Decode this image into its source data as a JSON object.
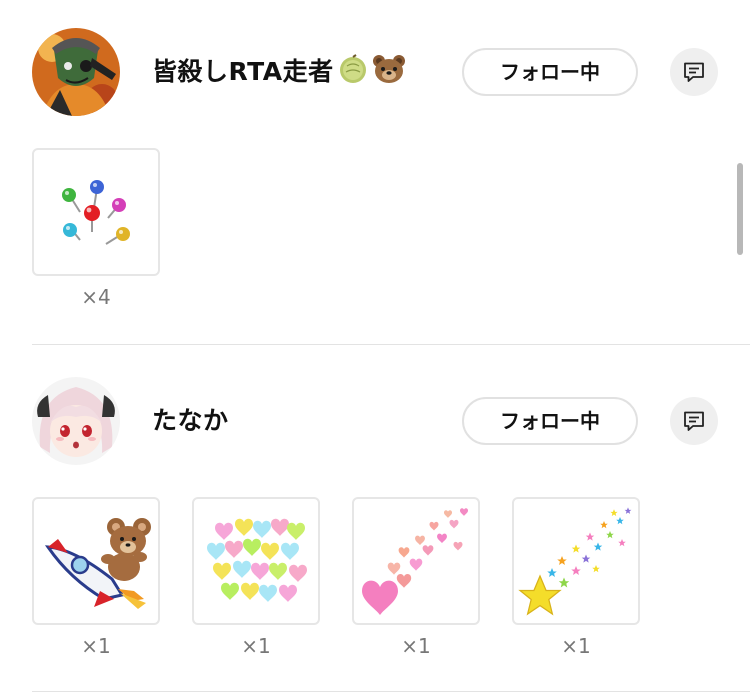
{
  "entries": [
    {
      "username": "皆殺しRTA走者",
      "follow_label": "フォロー中",
      "gifts": [
        {
          "name": "lollipops",
          "count_label": "×4"
        }
      ]
    },
    {
      "username": "たなか",
      "follow_label": "フォロー中",
      "gifts": [
        {
          "name": "bear-rocket",
          "count_label": "×1"
        },
        {
          "name": "heart-cluster",
          "count_label": "×1"
        },
        {
          "name": "heart-stream",
          "count_label": "×1"
        },
        {
          "name": "star-stream",
          "count_label": "×1"
        }
      ]
    }
  ],
  "icons": {
    "message": "message-icon",
    "melon": "melon-emoji-icon",
    "bear": "bear-emoji-icon"
  },
  "colors": {
    "button_border": "#e1e1e1",
    "message_button_bg": "#efefef",
    "count_text": "#777777",
    "divider": "#e3e3e3"
  }
}
